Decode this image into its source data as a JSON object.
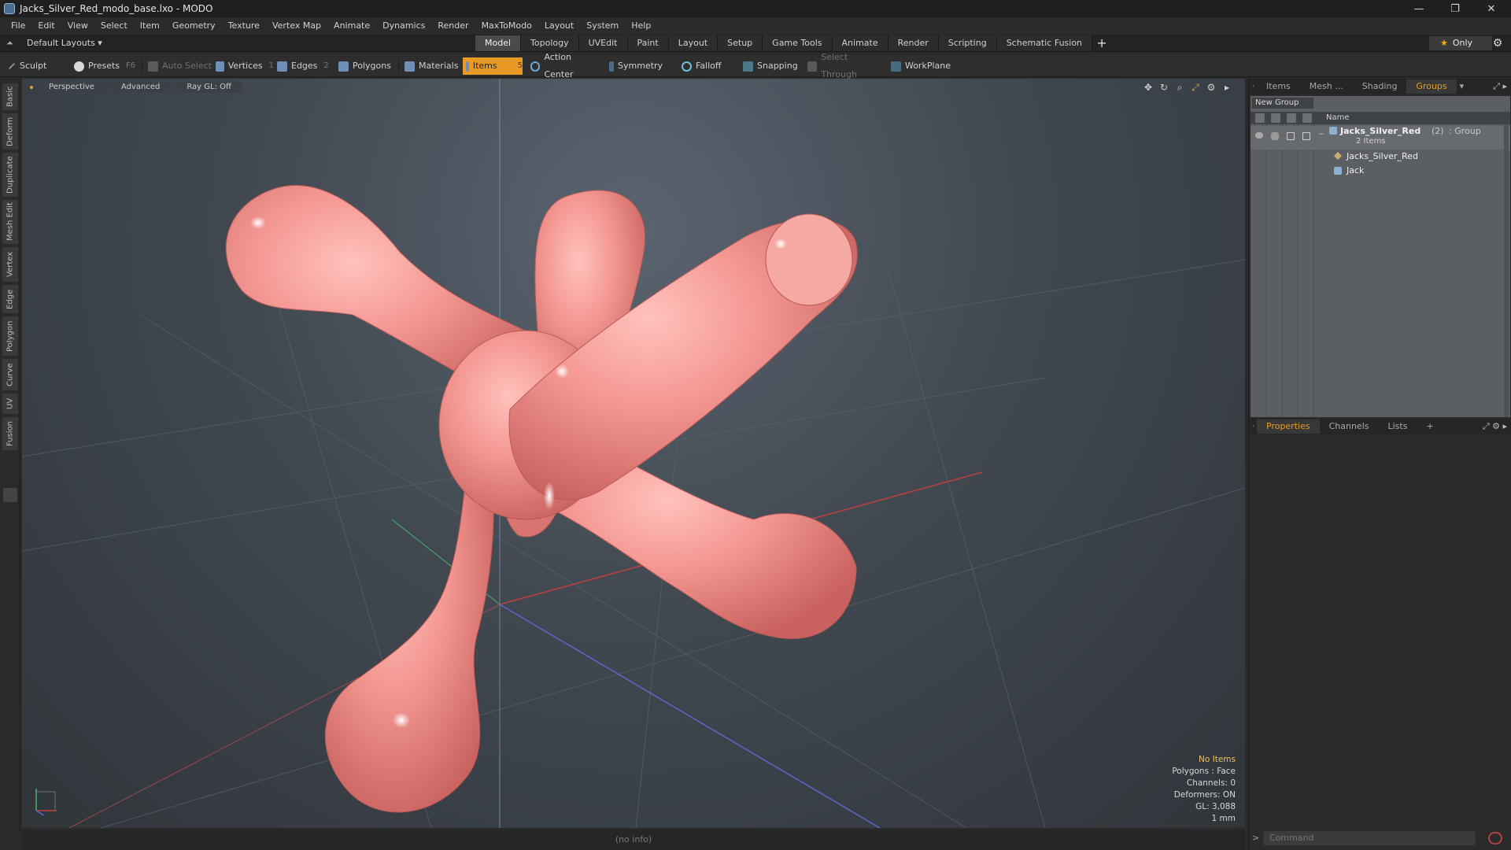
{
  "window": {
    "title": "Jacks_Silver_Red_modo_base.lxo - MODO",
    "controls": [
      "—",
      "❐",
      "✕"
    ]
  },
  "menu": [
    "File",
    "Edit",
    "View",
    "Select",
    "Item",
    "Geometry",
    "Texture",
    "Vertex Map",
    "Animate",
    "Dynamics",
    "Render",
    "MaxToModo",
    "Layout",
    "System",
    "Help"
  ],
  "layoutbar": {
    "layout_dropdown": "Default Layouts ▾",
    "tabs": [
      "Model",
      "Topology",
      "UVEdit",
      "Paint",
      "Layout",
      "Setup",
      "Game Tools",
      "Animate",
      "Render",
      "Scripting",
      "Schematic Fusion"
    ],
    "active_tab": "Model",
    "only_label": "Only"
  },
  "toolbar": {
    "sculpt": "Sculpt",
    "presets": "Presets",
    "presets_key": "F6",
    "auto_select": "Auto Select",
    "vertices": "Vertices",
    "vertices_key": "1",
    "edges": "Edges",
    "edges_key": "2",
    "polygons": "Polygons",
    "materials": "Materials",
    "items": "Items",
    "items_key": "5",
    "action_center": "Action Center",
    "symmetry": "Symmetry",
    "falloff": "Falloff",
    "snapping": "Snapping",
    "select_through": "Select Through",
    "workplane": "WorkPlane"
  },
  "left_tabs": [
    "Basic",
    "Deform",
    "Duplicate",
    "Mesh Edit",
    "Vertex",
    "Edge",
    "Polygon",
    "Curve",
    "UV",
    "Fusion"
  ],
  "viewport": {
    "tabs": [
      "Perspective",
      "Advanced",
      "Ray GL: Off"
    ],
    "info": {
      "selection": "No Items",
      "polygons": "Polygons : Face",
      "channels": "Channels: 0",
      "deformers": "Deformers: ON",
      "gl": "GL: 3,088",
      "unit": "1 mm"
    },
    "colors": {
      "mesh": "#f08e8a",
      "bg_top": "#5a6470",
      "bg_bottom": "#30353a"
    }
  },
  "statusbar": {
    "text": "(no info)"
  },
  "right_panel": {
    "top_tabs": [
      "Items",
      "Mesh ...",
      "Shading",
      "Groups"
    ],
    "active_top_tab": "Groups",
    "new_group": "New Group",
    "name_header": "Name",
    "tree": {
      "group_name": "Jacks_Silver_Red",
      "group_count": "(2)",
      "group_type": ": Group",
      "group_items": "2 Items",
      "children": [
        "Jacks_Silver_Red",
        "Jack"
      ]
    },
    "bottom_tabs": [
      "Properties",
      "Channels",
      "Lists"
    ],
    "active_bottom_tab": "Properties",
    "command_placeholder": "Command"
  }
}
